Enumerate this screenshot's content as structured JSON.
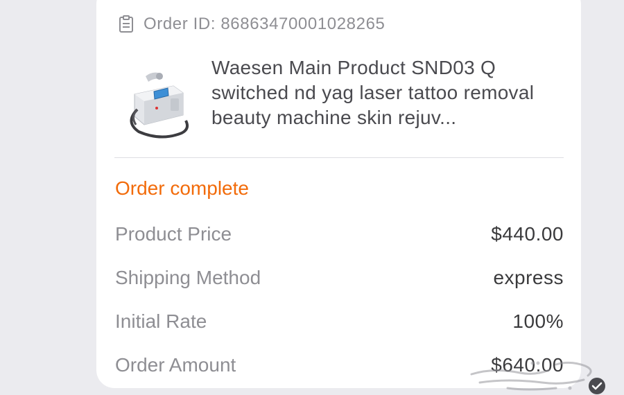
{
  "order": {
    "id_label": "Order ID: 86863470001028265",
    "product_title": "Waesen Main Product SND03 Q switched nd yag laser tattoo removal beauty machine skin rejuv...",
    "status": "Order complete",
    "status_color": "#f26b0a",
    "details": [
      {
        "label": "Product Price",
        "value": "$440.00"
      },
      {
        "label": "Shipping Method",
        "value": "express"
      },
      {
        "label": "Initial Rate",
        "value": "100%"
      },
      {
        "label": "Order Amount",
        "value": "$640.00"
      }
    ]
  },
  "icons": {
    "order_id": "clipboard-icon",
    "watermark": "arabic-watermark-logo",
    "badge": "check-circle-icon"
  }
}
